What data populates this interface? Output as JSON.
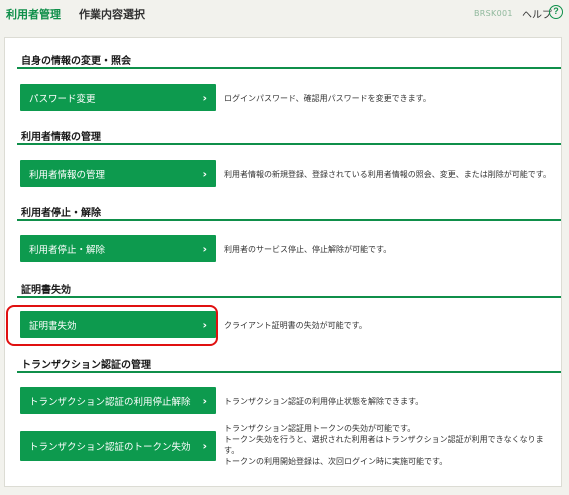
{
  "header": {
    "title": "利用者管理",
    "subtitle": "作業内容選択",
    "screen_id": "BRSK001",
    "help_label": "ヘルプ",
    "help_icon": "?"
  },
  "sections": [
    {
      "title": "自身の情報の変更・照会",
      "items": [
        {
          "button": "パスワード変更",
          "description": [
            "ログインパスワード、確認用パスワードを変更できます。"
          ]
        }
      ]
    },
    {
      "title": "利用者情報の管理",
      "items": [
        {
          "button": "利用者情報の管理",
          "description": [
            "利用者情報の新規登録、登録されている利用者情報の照会、変更、または削除が可能です。"
          ]
        }
      ]
    },
    {
      "title": "利用者停止・解除",
      "items": [
        {
          "button": "利用者停止・解除",
          "description": [
            "利用者のサービス停止、停止解除が可能です。"
          ]
        }
      ]
    },
    {
      "title": "証明書失効",
      "items": [
        {
          "button": "証明書失効",
          "description": [
            "クライアント証明書の失効が可能です。"
          ]
        }
      ]
    },
    {
      "title": "トランザクション認証の管理",
      "items": [
        {
          "button": "トランザクション認証の利用停止解除",
          "description": [
            "トランザクション認証の利用停止状態を解除できます。"
          ]
        },
        {
          "button": "トランザクション認証のトークン失効",
          "description": [
            "トランザクション認証用トークンの失効が可能です。",
            "トークン失効を行うと、選択された利用者はトランザクション認証が利用できなくなりま",
            "す。",
            "トークンの利用開始登録は、次回ログイン時に実施可能です。"
          ]
        }
      ]
    }
  ],
  "chevron": "›",
  "colors": {
    "accent": "#0d9a4e",
    "highlight": "#e01010"
  }
}
